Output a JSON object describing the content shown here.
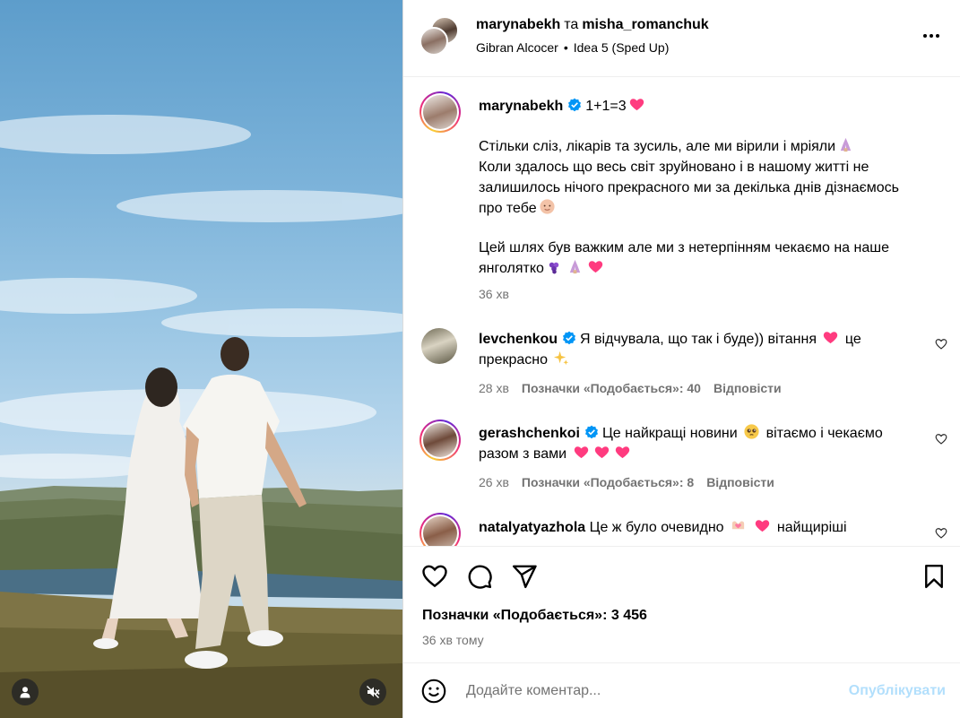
{
  "header": {
    "user1": "marynabekh",
    "separator": "та",
    "user2": "misha_romanchuk",
    "music_artist": "Gibran Alcocer",
    "music_dot": "•",
    "music_track": "Idea 5 (Sped Up)"
  },
  "caption": {
    "username": "marynabekh",
    "line1": "1+1=3",
    "paragraph1": "Стільки сліз, лікарів та зусиль, але ми вірили і мріяли",
    "paragraph2": "Коли здалось що весь світ зруйновано і в нашому житті не залишилось нічого прекрасного ми за декілька днів дізнаємось про тебе",
    "paragraph3": "Цей шлях був важким але ми з нетерпінням чекаємо на наше янголятко",
    "time": "36 хв"
  },
  "comments": [
    {
      "username": "levchenkou",
      "text_a": "Я відчувала, що так і буде)) вітання",
      "text_b": "це прекрасно",
      "time": "28 хв",
      "likes": "Позначки «Подобається»: 40",
      "reply": "Відповісти"
    },
    {
      "username": "gerashchenkoi",
      "text_a": "Це найкращі новини",
      "text_b": "вітаємо і чекаємо разом з вами",
      "time": "26 хв",
      "likes": "Позначки «Подобається»: 8",
      "reply": "Відповісти"
    },
    {
      "username": "natalyatyazhola",
      "text_a": "Це ж було очевидно",
      "text_b": "найщиріші"
    }
  ],
  "actions": {
    "likes_label": "Позначки «Подобається»: 3 456",
    "time_ago": "36 хв тому"
  },
  "composer": {
    "placeholder": "Додайте коментар...",
    "publish_label": "Опублікувати"
  },
  "icons": {
    "like": "heart-icon",
    "comment": "comment-icon",
    "share": "share-icon",
    "save": "bookmark-icon",
    "emoji": "emoji-icon",
    "more": "more-options-icon",
    "mute": "muted-speaker-icon",
    "tags": "user-tag-icon"
  },
  "colors": {
    "verified": "#0095f6",
    "publish_disabled": "#b2dffc",
    "meta": "#737373",
    "heart_emoji": "#ff3b7f"
  }
}
